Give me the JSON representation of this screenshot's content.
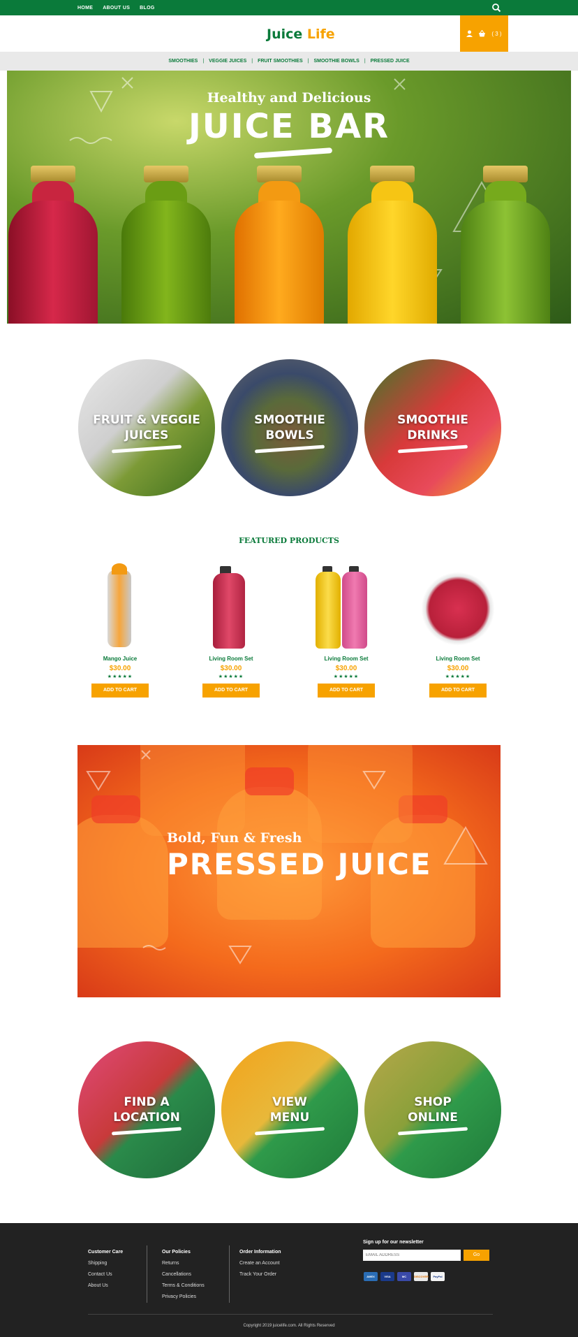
{
  "colors": {
    "brand_green": "#0a7a3a",
    "accent_orange": "#f7a200",
    "footer_bg": "#222222"
  },
  "topbar": {
    "links": [
      "HOME",
      "ABOUT US",
      "BLOG"
    ],
    "search_icon": "search-icon"
  },
  "header": {
    "logo_part1": "Juice",
    "logo_part2": "Life",
    "cart_count": "( 3 )",
    "user_icon": "user-icon",
    "cart_icon": "basket-icon"
  },
  "category_nav": [
    "SMOOTHIES",
    "VEGGIE JUICES",
    "FRUIT SMOOTHIES",
    "SMOOTHIE BOWLS",
    "PRESSED JUICE"
  ],
  "hero": {
    "subtitle": "Healthy and Delicious",
    "title": "JUICE BAR"
  },
  "category_circles": [
    {
      "line1": "FRUIT & VEGGIE",
      "line2": "JUICES"
    },
    {
      "line1": "SMOOTHIE",
      "line2": "BOWLS"
    },
    {
      "line1": "SMOOTHIE",
      "line2": "DRINKS"
    }
  ],
  "featured": {
    "title": "FEATURED PRODUCTS",
    "products": [
      {
        "name": "Mango Juice",
        "price": "$30.00",
        "stars": "★★★★★",
        "button": "ADD TO CART"
      },
      {
        "name": "Living Room Set",
        "price": "$30.00",
        "stars": "★★★★★",
        "button": "ADD TO CART"
      },
      {
        "name": "Living Room Set",
        "price": "$30.00",
        "stars": "★★★★★",
        "button": "ADD TO CART"
      },
      {
        "name": "Living Room Set",
        "price": "$30.00",
        "stars": "★★★★★",
        "button": "ADD TO CART"
      }
    ]
  },
  "banner2": {
    "subtitle": "Bold, Fun & Fresh",
    "title": "PRESSED JUICE"
  },
  "action_circles": [
    {
      "line1": "FIND A",
      "line2": "LOCATION"
    },
    {
      "line1": "VIEW",
      "line2": "MENU"
    },
    {
      "line1": "SHOP",
      "line2": "ONLINE"
    }
  ],
  "footer": {
    "col1": {
      "heading": "Customer Care",
      "links": [
        "Shipping",
        "Contact Us",
        "About Us"
      ]
    },
    "col2": {
      "heading": "Our Policies",
      "links": [
        "Returns",
        "Cancellations",
        "Terms & Conditions",
        "Privacy Policies"
      ]
    },
    "col3": {
      "heading": "Order Information",
      "links": [
        "Create an Account",
        "Track Your Order"
      ]
    },
    "newsletter": {
      "heading": "Sign up for our newsletter",
      "placeholder": "EMAIL ADDRESS",
      "button": "Go"
    },
    "payments": [
      "AMEX",
      "VISA",
      "MC",
      "DISCOVER",
      "PayPal"
    ],
    "copyright": "Copyright 2019 juicelife.com. All Rights Reserved"
  }
}
